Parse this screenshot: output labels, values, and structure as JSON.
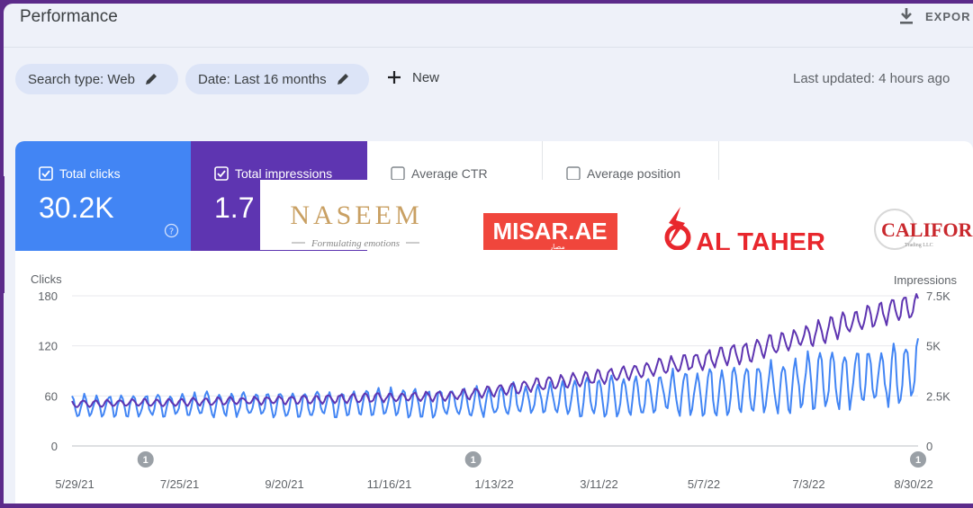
{
  "header": {
    "title": "Performance",
    "export_label": "EXPOR"
  },
  "filters": {
    "search_type": "Search type: Web",
    "date": "Date: Last 16 months",
    "new_label": "New",
    "last_updated": "Last updated: 4 hours ago"
  },
  "metrics": [
    {
      "label": "Total clicks",
      "value": "30.2K",
      "checked": true,
      "color": "#4285f4"
    },
    {
      "label": "Total impressions",
      "value": "1.7",
      "checked": true,
      "color": "#5e35b1"
    },
    {
      "label": "Average CTR",
      "value": "",
      "checked": false
    },
    {
      "label": "Average position",
      "value": "",
      "checked": false
    }
  ],
  "logos": {
    "naseem": "NASEEM",
    "naseem_tagline": "Formulating emotions",
    "misar": "MISAR.AE",
    "misar_arabic": "مصار",
    "altaher": "AL TAHER",
    "california": "CALIFOR",
    "california_sub": "Trading LLC"
  },
  "chart_data": {
    "type": "line",
    "ylabel_left": "Clicks",
    "ylabel_right": "Impressions",
    "ylim_left": [
      0,
      180
    ],
    "ylim_right": [
      0,
      7500
    ],
    "yticks_left": [
      "180",
      "120",
      "60",
      "0"
    ],
    "yticks_right": [
      "7.5K",
      "5K",
      "2.5K",
      "0"
    ],
    "x_ticks": [
      "5/29/21",
      "7/25/21",
      "9/20/21",
      "11/16/21",
      "1/13/22",
      "3/11/22",
      "5/7/22",
      "7/3/22",
      "8/30/22"
    ],
    "x_start": "2021-05-29",
    "x_end": "2022-09-24",
    "annotations": [
      {
        "date": "2021-07-10",
        "label": "1"
      },
      {
        "date": "2022-01-13",
        "label": "1"
      },
      {
        "date": "2022-09-24",
        "label": "1"
      }
    ],
    "series": [
      {
        "name": "Total clicks",
        "color": "#4285f4",
        "axis": "left",
        "trend": [
          [
            0,
            48
          ],
          [
            0.2,
            50
          ],
          [
            0.45,
            52
          ],
          [
            0.65,
            60
          ],
          [
            0.8,
            68
          ],
          [
            1,
            90
          ]
        ],
        "weekly_amp": [
          [
            0,
            12
          ],
          [
            0.45,
            16
          ],
          [
            0.65,
            22
          ],
          [
            1,
            36
          ]
        ]
      },
      {
        "name": "Total impressions",
        "color": "#5e35b1",
        "axis": "right",
        "trend": [
          [
            0,
            2100
          ],
          [
            0.2,
            2250
          ],
          [
            0.45,
            2500
          ],
          [
            0.65,
            3600
          ],
          [
            0.8,
            4700
          ],
          [
            0.9,
            5900
          ],
          [
            0.98,
            6900
          ],
          [
            1,
            7000
          ]
        ],
        "weekly_amp": [
          [
            0,
            150
          ],
          [
            0.45,
            220
          ],
          [
            0.65,
            350
          ],
          [
            1,
            600
          ]
        ]
      }
    ]
  }
}
